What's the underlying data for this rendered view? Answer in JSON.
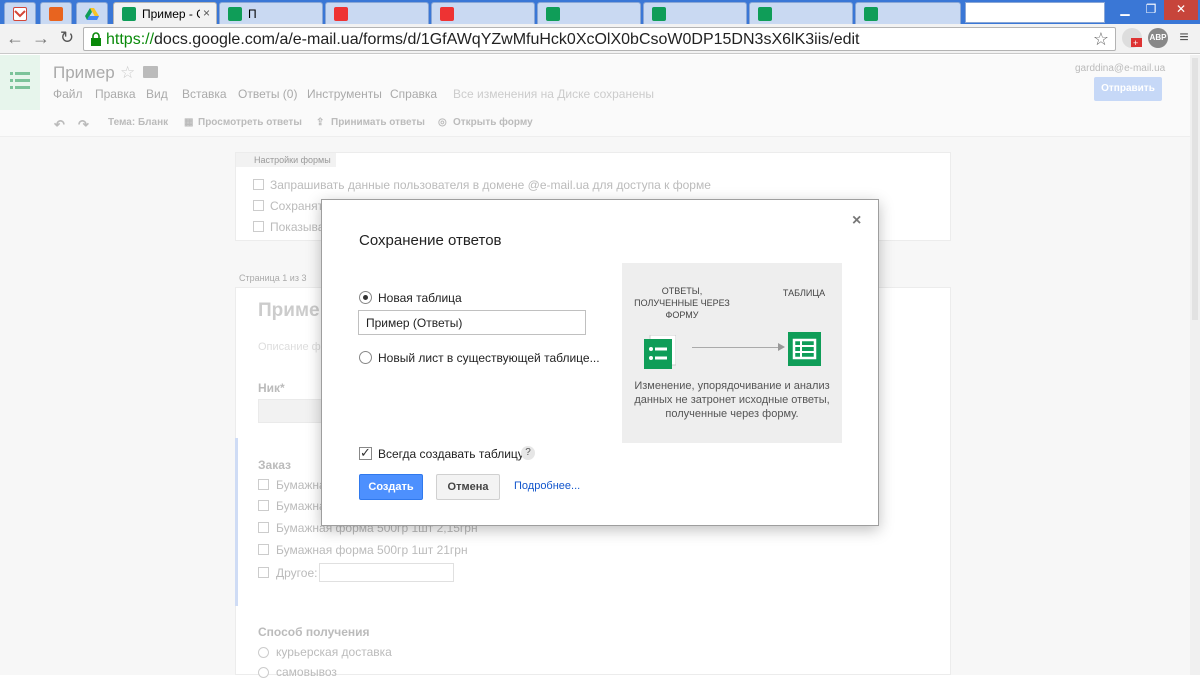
{
  "browser": {
    "tabs": [
      {
        "label": ""
      },
      {
        "label": ""
      },
      {
        "label": ""
      },
      {
        "label": "Пример - Go"
      },
      {
        "label": "П"
      }
    ],
    "url_scheme": "https://",
    "url_rest": "docs.google.com/a/e-mail.ua/forms/d/1GfAWqYZwMfuHck0XcOlX0bCsoW0DP15DN3sX6lK3iis/edit",
    "colors": {
      "tabstrip": "#3a77d6",
      "gmail_red": "#d44638",
      "drive_yellow": "#f7c325",
      "forms_green": "#0f9d58",
      "sheets_green": "#0f9d58"
    }
  },
  "docs": {
    "title": "Пример",
    "menu": [
      "Файл",
      "Правка",
      "Вид",
      "Вставка",
      "Ответы (0)",
      "Инструменты",
      "Справка"
    ],
    "saved": "Все изменения на Диске сохранены",
    "account": "garddina@e-mail.ua",
    "send_label": "Отправить",
    "toolbar": {
      "theme": "Тема: Бланк",
      "view_responses": "Просмотреть ответы",
      "accept_responses": "Принимать ответы",
      "open_form": "Открыть форму"
    }
  },
  "form_bg": {
    "settings_header": "Настройки формы",
    "settings": [
      "Запрашивать данные пользователя в домене @e-mail.ua для доступа к форме",
      "Сохранят",
      "Показыва"
    ],
    "page_label": "Страница 1 из 3",
    "form_title": "Приме",
    "description": "Описание ф",
    "q_nick": "Ник*",
    "q_order": "Заказ",
    "order_options": [
      "Бумажна",
      "Бумажна",
      "Бумажная форма 500гр 1шт 2,15грн",
      "Бумажная форма 500гр 1шт 21грн",
      "Другое:"
    ],
    "q_delivery": "Способ получения",
    "delivery_options": [
      "курьерская доставка",
      "самовывоз"
    ]
  },
  "dialog": {
    "title": "Сохранение ответов",
    "close": "×",
    "option_new": "Новая таблица",
    "table_name": "Пример (Ответы)",
    "option_existing": "Новый лист в существующей таблице...",
    "always_create": "Всегда создавать таблицу",
    "help": "?",
    "create_label": "Создать",
    "cancel_label": "Отмена",
    "more_label": "Подробнее...",
    "illus_left": "ОТВЕТЫ, ПОЛУЧЕННЫЕ ЧЕРЕЗ ФОРМУ",
    "illus_right": "ТАБЛИЦА",
    "illus_caption": "Изменение, упорядочивание и анализ данных не затронет исходные ответы, полученные через форму."
  }
}
